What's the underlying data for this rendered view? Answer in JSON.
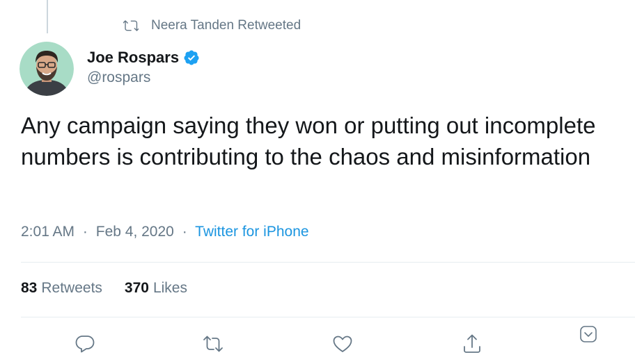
{
  "retweet_context": {
    "text": "Neera Tanden Retweeted"
  },
  "author": {
    "display_name": "Joe Rospars",
    "handle": "@rospars",
    "verified_color": "#1da1f2"
  },
  "tweet": {
    "text": "Any campaign saying they won or putting out incomplete numbers is contributing to the chaos and misinformation"
  },
  "meta": {
    "time": "2:01 AM",
    "separator": "·",
    "date": "Feb 4, 2020",
    "source": "Twitter for iPhone"
  },
  "stats": {
    "retweets_count": "83",
    "retweets_label": "Retweets",
    "likes_count": "370",
    "likes_label": "Likes"
  },
  "actions": {
    "icons": [
      "reply-icon",
      "retweet-icon",
      "like-icon",
      "share-icon"
    ]
  },
  "colors": {
    "text_primary": "#14171a",
    "text_secondary": "#657786",
    "link": "#1b95e0",
    "border": "#e6ecf0"
  }
}
